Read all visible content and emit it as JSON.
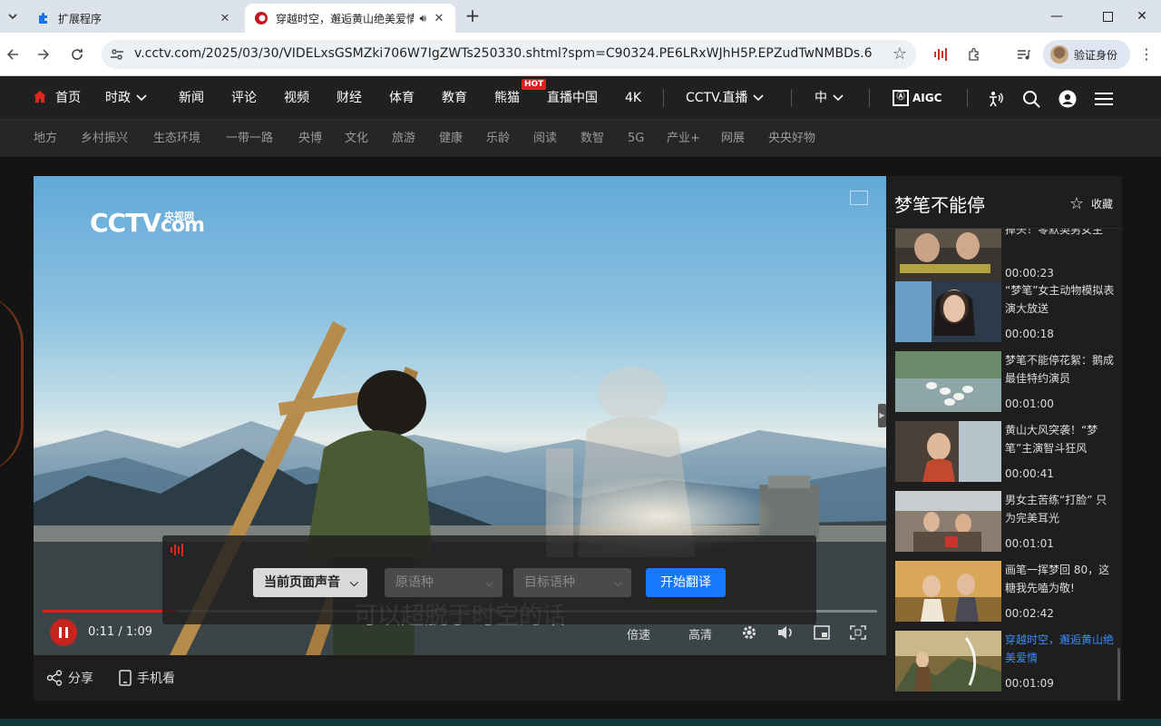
{
  "browser": {
    "tabs": [
      {
        "title": "扩展程序",
        "active": false
      },
      {
        "title": "穿越时空，邂逅黄山绝美爱情",
        "active": true,
        "audio": true
      }
    ],
    "url": "v.cctv.com/2025/03/30/VIDELxsGSMZki706W7IgZWTs250330.shtml?spm=C90324.PE6LRxWJhH5P.EPZudTwNMBDs.6",
    "profile_label": "验证身份"
  },
  "site_nav": {
    "items": [
      "首页",
      "时政",
      "新闻",
      "评论",
      "视频",
      "财经",
      "体育",
      "教育",
      "熊猫",
      "直播中国",
      "4K",
      "CCTV.直播",
      "中"
    ],
    "hot_badge": "HOT",
    "aigc_label": "AIGC"
  },
  "sub_nav": {
    "items": [
      "地方",
      "乡村振兴",
      "生态环境",
      "一带一路",
      "央博",
      "文化",
      "旅游",
      "健康",
      "乐龄",
      "阅读",
      "数智",
      "5G",
      "产业+",
      "网展",
      "央央好物"
    ]
  },
  "player": {
    "logo_text": "CCTV",
    "logo_com": "com",
    "logo_cn": "央视网",
    "caption": "可以超脱于时空的话",
    "time": "0:11 / 1:09",
    "progress": 0.16,
    "speed_label": "倍速",
    "quality_label": "高清",
    "translate": {
      "source_audio": "当前页面声音",
      "source_lang_placeholder": "原语种",
      "target_lang_placeholder": "目标语种",
      "start_label": "开始翻译"
    }
  },
  "below_player": {
    "share_label": "分享",
    "mobile_label": "手机看"
  },
  "playlist": {
    "title": "梦笔不能停",
    "fav_label": "收藏",
    "items": [
      {
        "title": "掉头！零默契男女主",
        "duration": "00:00:23",
        "current": false
      },
      {
        "title": "“梦笔”女主动物模拟表演大放送",
        "duration": "00:00:18",
        "current": false
      },
      {
        "title": "梦笔不能停花絮：鹅成最佳特约演员",
        "duration": "00:01:00",
        "current": false
      },
      {
        "title": "黄山大风突袭！“梦笔”主演智斗狂风",
        "duration": "00:00:41",
        "current": false
      },
      {
        "title": "男女主苦练“打脸” 只为完美耳光",
        "duration": "00:01:01",
        "current": false
      },
      {
        "title": "画笔一挥梦回 80，这糖我先嗑为敬!",
        "duration": "00:02:42",
        "current": false
      },
      {
        "title": "穿越时空，邂逅黄山绝美爱情",
        "duration": "00:01:09",
        "current": true
      }
    ]
  },
  "colors": {
    "accent_red": "#e02020",
    "translate_blue": "#1677ff",
    "current_blue": "#3a8bff"
  }
}
